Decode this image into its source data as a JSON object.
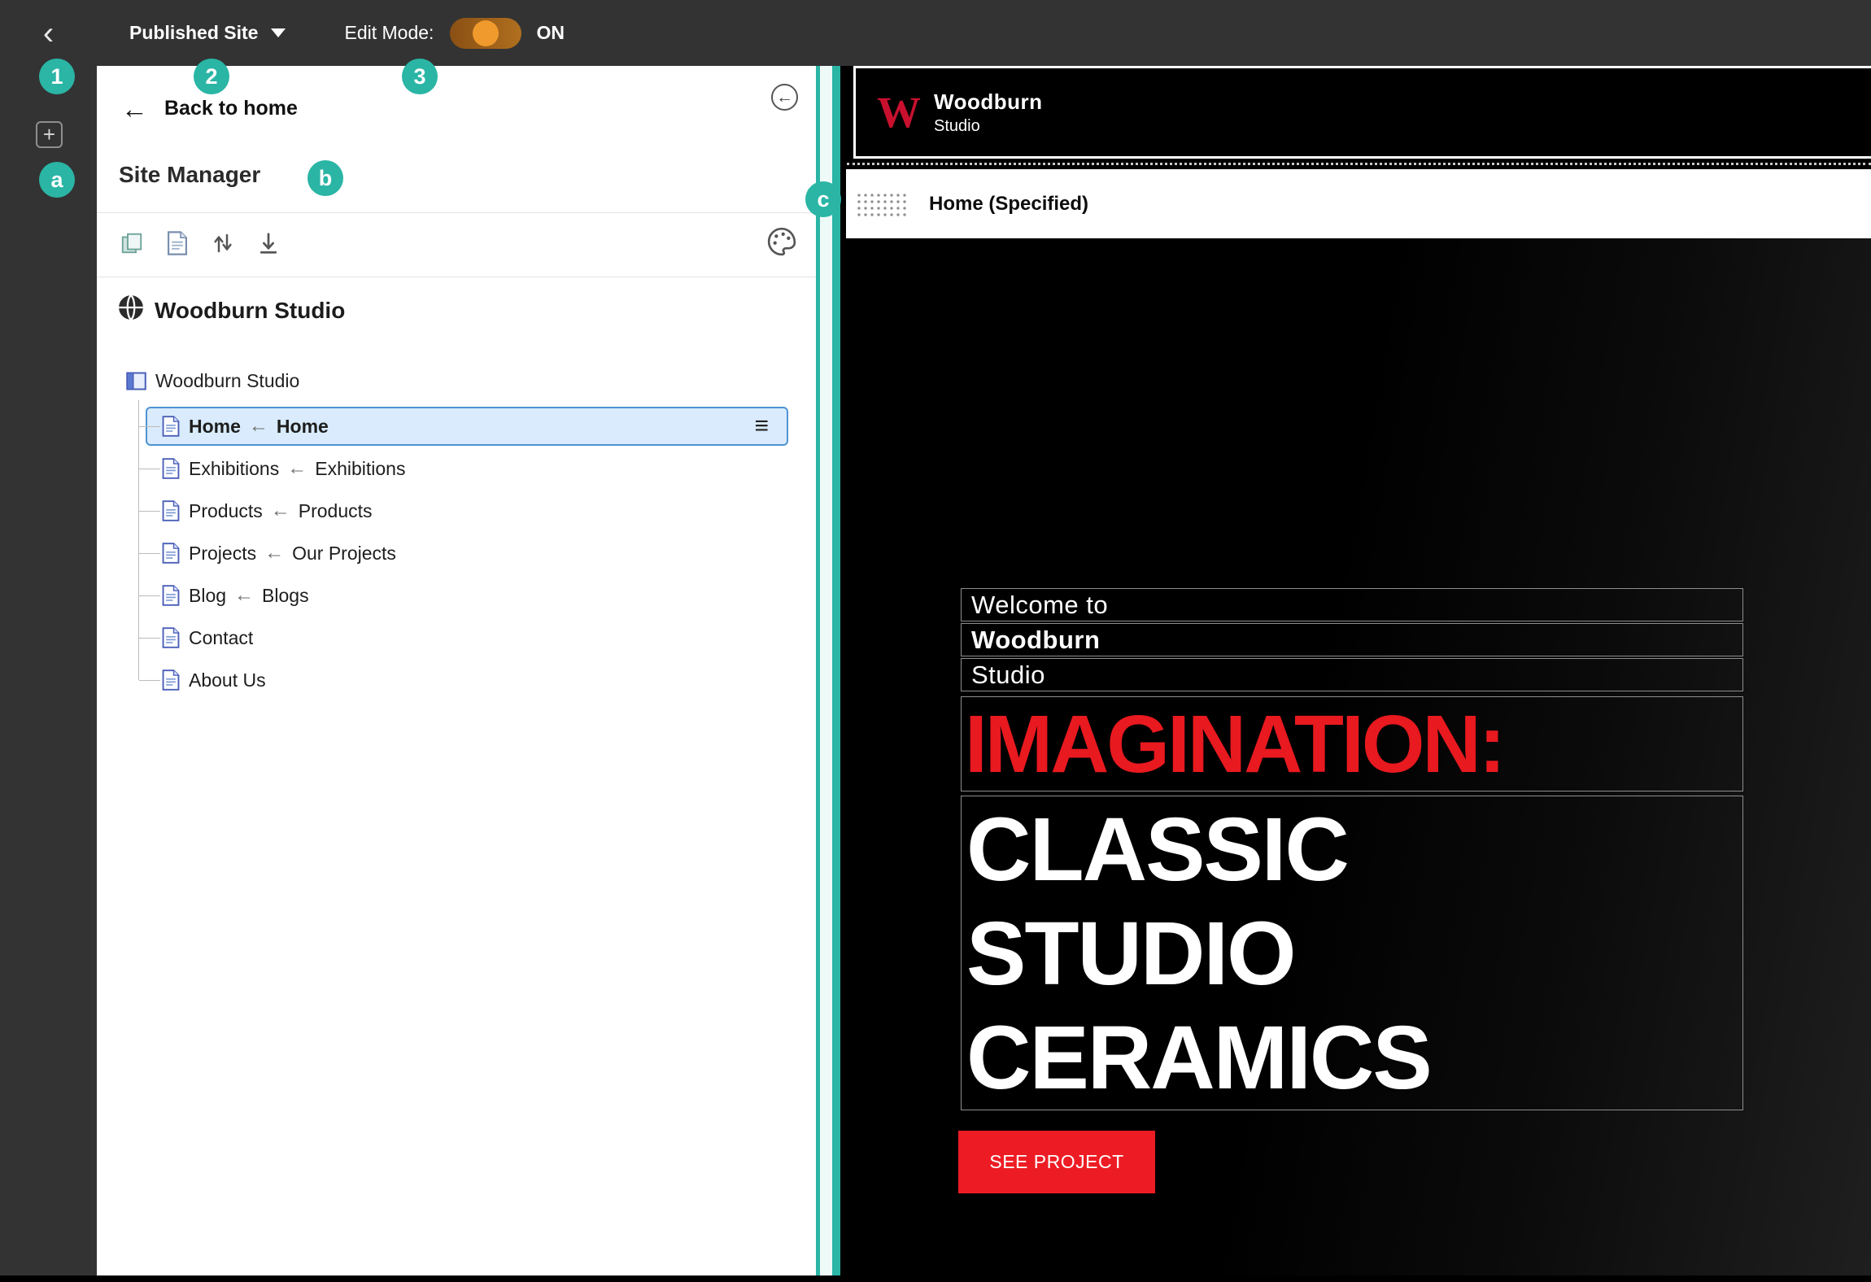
{
  "topbar": {
    "published_site": "Published Site",
    "edit_mode_label": "Edit Mode:",
    "edit_mode_state": "ON"
  },
  "icons": {
    "back_chevron": "‹",
    "back_arrow": "←",
    "collapse_arrow": "←",
    "plus": "+",
    "menu": "≡"
  },
  "badges": {
    "n1": "1",
    "n2": "2",
    "n3": "3",
    "la": "a",
    "lb": "b",
    "lc": "c"
  },
  "panel": {
    "back_link": "Back to home",
    "title": "Site Manager",
    "site_name": "Woodburn Studio",
    "tree": {
      "root": "Woodburn Studio",
      "items": [
        {
          "label": "Home",
          "arrow": "←",
          "target": "Home",
          "selected": true
        },
        {
          "label": "Exhibitions",
          "arrow": "←",
          "target": "Exhibitions"
        },
        {
          "label": "Products",
          "arrow": "←",
          "target": "Products"
        },
        {
          "label": "Projects",
          "arrow": "←",
          "target": "Our Projects"
        },
        {
          "label": "Blog",
          "arrow": "←",
          "target": "Blogs"
        },
        {
          "label": "Contact"
        },
        {
          "label": "About Us"
        }
      ]
    }
  },
  "preview": {
    "logo_letter": "W",
    "logo_name": "Woodburn",
    "logo_sub": "Studio",
    "region_label": "Home (Specified)",
    "hero": {
      "intro_line1": "Welcome to",
      "intro_line2": "Woodburn",
      "intro_line3": "Studio",
      "headline_accent": "IMAGINATION:",
      "headline_line1": "CLASSIC",
      "headline_line2": "STUDIO",
      "headline_line3": "CERAMICS",
      "cta": "SEE PROJECT"
    }
  },
  "colors": {
    "accent_teal": "#2ab5a5",
    "brand_red": "#e8191f",
    "button_red": "#ed1c24",
    "toggle_knob": "#f09a2d",
    "selected_border": "#4f93d4",
    "selected_bg": "#d9ebfc"
  }
}
